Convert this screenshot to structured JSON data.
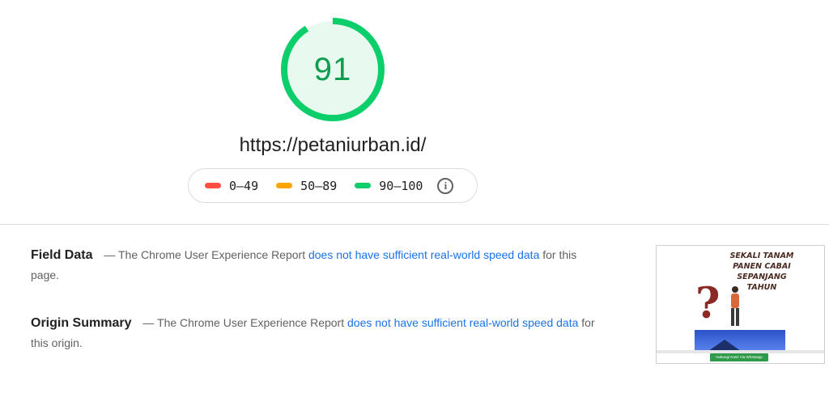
{
  "score": {
    "value": "91",
    "fraction": 0.91,
    "color": "#0cce6b"
  },
  "url": "https://petaniurban.id/",
  "legend": {
    "items": [
      {
        "label": "0–49",
        "color": "#ff4e42"
      },
      {
        "label": "50–89",
        "color": "#ffa400"
      },
      {
        "label": "90–100",
        "color": "#0cce6b"
      }
    ],
    "info_icon": "info-icon"
  },
  "field_data": {
    "title": "Field Data",
    "prefix": "— The Chrome User Experience Report",
    "link": "does not have sufficient real-world speed data",
    "suffix": "for this page."
  },
  "origin_summary": {
    "title": "Origin Summary",
    "prefix": "— The Chrome User Experience Report",
    "link": "does not have sufficient real-world speed data",
    "suffix": "for this origin."
  },
  "thumbnail": {
    "line1": "SEKALI TANAM",
    "line2": "PANEN CABAI",
    "line3": "SEPANJANG",
    "line4": "TAHUN",
    "button": "Hubungi Kami Via Whatsapp"
  }
}
